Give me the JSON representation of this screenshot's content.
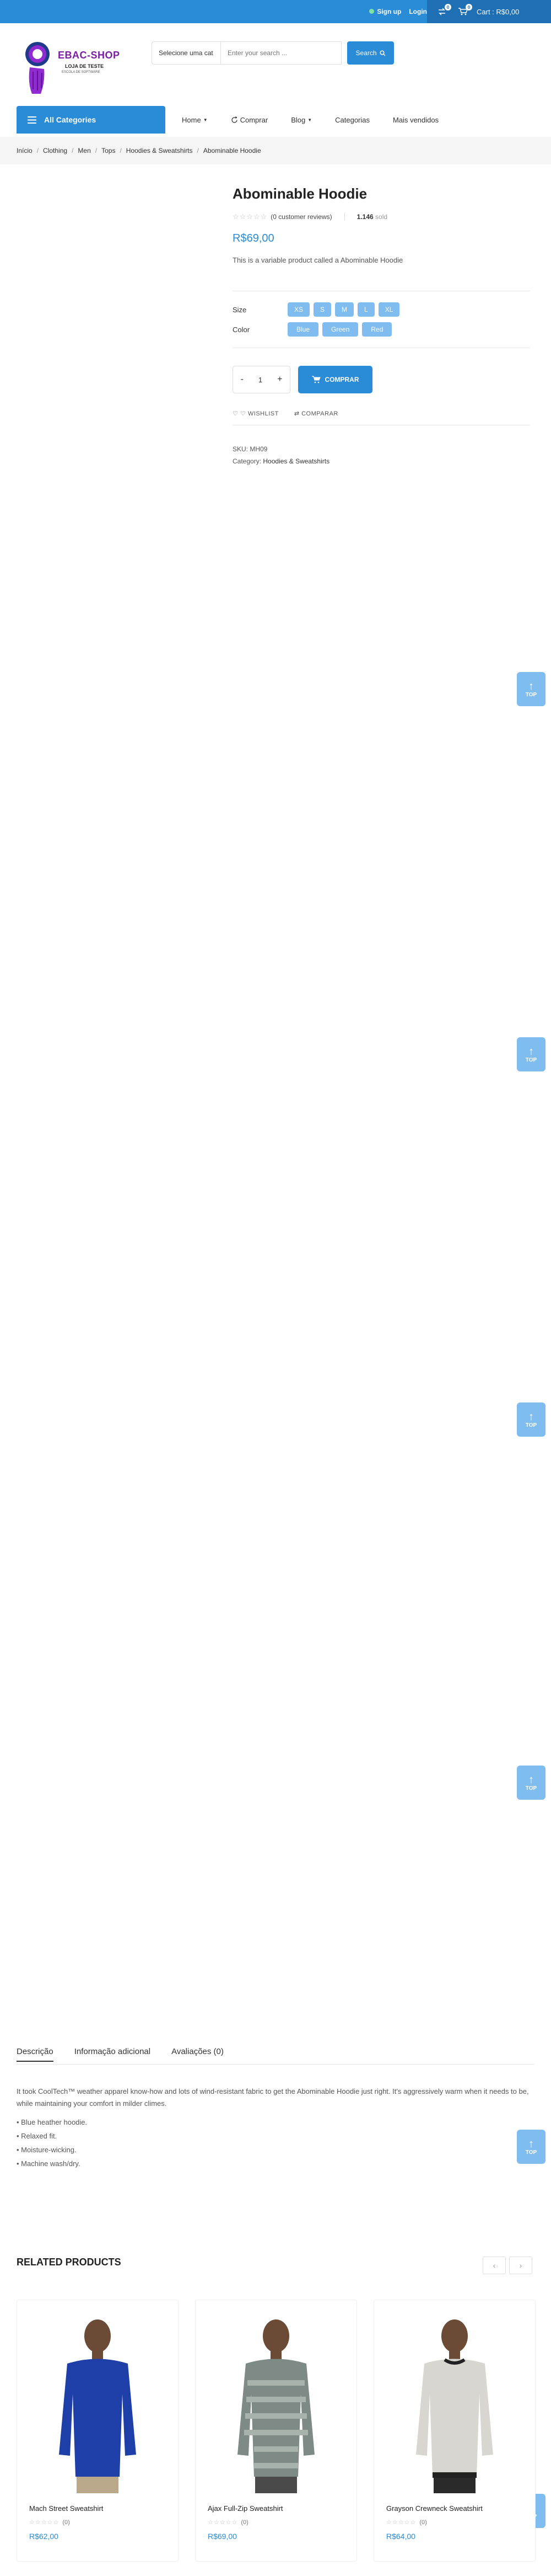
{
  "topbar": {
    "signup": "Sign up",
    "login": "Login",
    "cart": "Cart : R$0,00",
    "compare_count": "0",
    "wishlist_count": "0"
  },
  "logo": {
    "name": "EBAC-SHOP",
    "line1": "LOJA DE TESTE",
    "line2": "ESCOLA DE SOFTWARE"
  },
  "search": {
    "category": "Selecione uma cat",
    "placeholder": "Enter your search ...",
    "button": "Search"
  },
  "nav": {
    "all_categories": "All Categories",
    "items": [
      "Home",
      "Comprar",
      "Blog",
      "Categorias",
      "Mais vendidos"
    ]
  },
  "breadcrumb": [
    "Início",
    "Clothing",
    "Men",
    "Tops",
    "Hoodies & Sweatshirts",
    "Abominable Hoodie"
  ],
  "product": {
    "title": "Abominable Hoodie",
    "reviews": "(0 customer reviews)",
    "sold_count": "1.146",
    "sold_label": "sold",
    "price": "R$69,00",
    "short_desc": "This is a variable product called a Abominable Hoodie",
    "size_label": "Size",
    "sizes": [
      "XS",
      "S",
      "M",
      "L",
      "XL"
    ],
    "color_label": "Color",
    "colors": [
      "Blue",
      "Green",
      "Red"
    ],
    "quantity": "1",
    "buy_button": "COMPRAR",
    "wishlist": "WISHLIST",
    "compare": "COMPARAR",
    "sku": "SKU: MH09",
    "category_label": "Category:",
    "category": "Hoodies & Sweatshirts"
  },
  "top_label": "TOP",
  "tabs": {
    "items": [
      "Descrição",
      "Informação adicional",
      "Avaliações (0)"
    ],
    "description": "It took CoolTech™ weather apparel know-how and lots of wind-resistant fabric to get the Abominable Hoodie just right. It's aggressively warm when it needs to be, while maintaining your comfort in milder climes.",
    "bullets": [
      "• Blue heather hoodie.",
      "• Relaxed fit.",
      "• Moisture-wicking.",
      "• Machine wash/dry."
    ]
  },
  "related": {
    "title": "RELATED PRODUCTS",
    "products": [
      {
        "name": "Mach Street Sweatshirt",
        "rating": "(0)",
        "price": "R$62,00",
        "color": "#1f3fa8"
      },
      {
        "name": "Ajax Full-Zip Sweatshirt",
        "rating": "(0)",
        "price": "R$69,00",
        "color": "#7d8a86"
      },
      {
        "name": "Grayson Crewneck Sweatshirt",
        "rating": "(0)",
        "price": "R$64,00",
        "color": "#d8d6d0"
      }
    ]
  },
  "colors": {
    "accent": "#2a8bd6",
    "accent_dark": "#1e6fb3",
    "swatch": "#7fbcef"
  }
}
